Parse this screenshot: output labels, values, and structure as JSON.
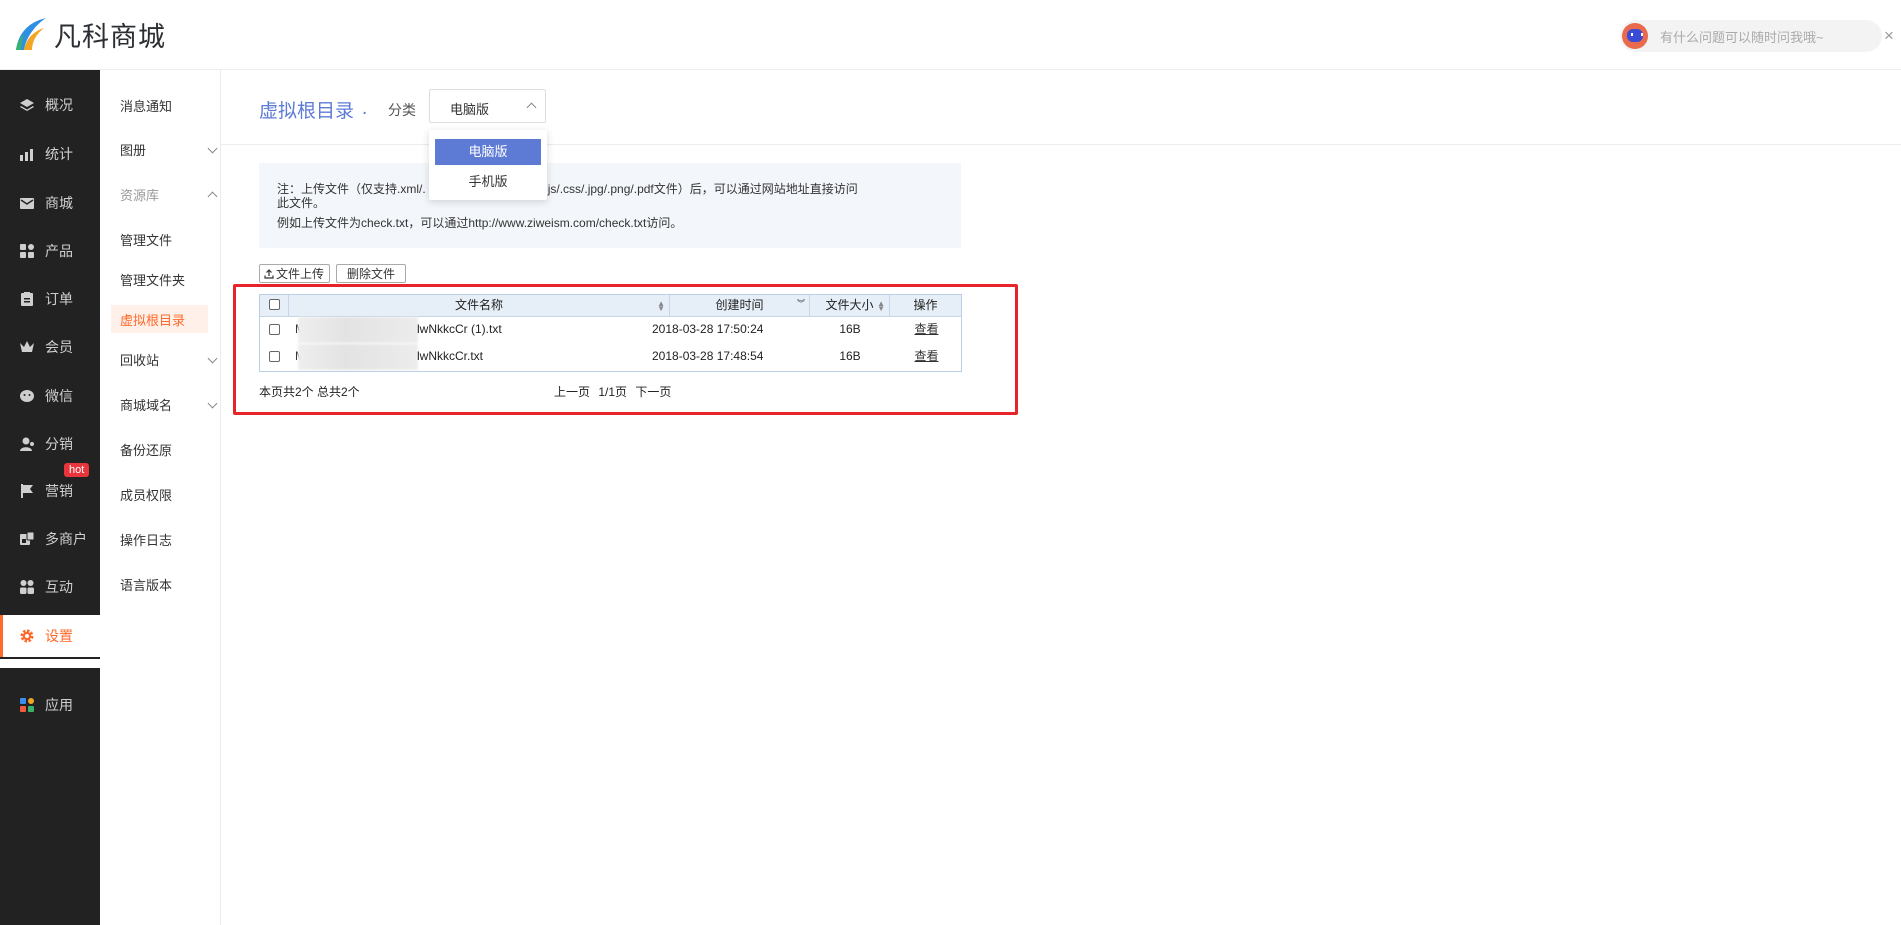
{
  "brand": {
    "name": "凡科商城"
  },
  "helper": {
    "placeholder": "有什么问题可以随时问我哦~",
    "close": "×"
  },
  "nav": {
    "items": [
      {
        "label": "概况",
        "icon": "layers-icon"
      },
      {
        "label": "统计",
        "icon": "chart-icon"
      },
      {
        "label": "商城",
        "icon": "mail-icon"
      },
      {
        "label": "产品",
        "icon": "grid-icon"
      },
      {
        "label": "订单",
        "icon": "clipboard-icon"
      },
      {
        "label": "会员",
        "icon": "crown-icon"
      },
      {
        "label": "微信",
        "icon": "wechat-icon"
      },
      {
        "label": "分销",
        "icon": "user-share-icon"
      },
      {
        "label": "营销",
        "icon": "flag-icon"
      },
      {
        "label": "多商户",
        "icon": "multi-shop-icon"
      },
      {
        "label": "互动",
        "icon": "people-icon"
      },
      {
        "label": "设置",
        "icon": "gear-icon"
      },
      {
        "label": "应用",
        "icon": "apps-icon"
      }
    ],
    "hot_badge": "hot",
    "active": "设置"
  },
  "subnav": {
    "items": [
      {
        "label": "消息通知"
      },
      {
        "label": "图册",
        "chevron": "down"
      },
      {
        "label": "资源库",
        "chevron": "up"
      },
      {
        "label": "管理文件"
      },
      {
        "label": "管理文件夹"
      },
      {
        "label": "虚拟根目录"
      },
      {
        "label": "回收站",
        "chevron": "down"
      },
      {
        "label": "商城域名",
        "chevron": "down"
      },
      {
        "label": "备份还原"
      },
      {
        "label": "成员权限"
      },
      {
        "label": "操作日志"
      },
      {
        "label": "语言版本"
      }
    ],
    "active": "虚拟根目录"
  },
  "header": {
    "title": "虚拟根目录",
    "title_suffix": ".",
    "category_label": "分类",
    "category_value": "电脑版",
    "category_options": [
      "电脑版",
      "手机版"
    ]
  },
  "note": {
    "line1_a": "注：上传文件（仅支持.xml/.",
    "line1_b": "/.cert/.bin/.js/.css/.jpg/.png/.pdf文件）后，可以通过网站地址直接访问",
    "line2": "此文件。",
    "line3": "例如上传文件为check.txt，可以通过http://www.ziweism.com/check.txt访问。"
  },
  "toolbar": {
    "upload": "文件上传",
    "delete": "删除文件"
  },
  "table": {
    "headers": [
      "文件名称",
      "创建时间",
      "文件大小",
      "操作"
    ],
    "rows": [
      {
        "prefix": "M",
        "name": "lwNkkcCr (1).txt",
        "time": "2018-03-28 17:50:24",
        "size": "16B",
        "action": "查看"
      },
      {
        "prefix": "M",
        "name": "lwNkkcCr.txt",
        "time": "2018-03-28 17:48:54",
        "size": "16B",
        "action": "查看"
      }
    ],
    "summary": "本页共2个 总共2个",
    "pager": {
      "prev": "上一页",
      "page": "1/1页",
      "next": "下一页"
    }
  },
  "colors": {
    "accent": "#ff6a2c",
    "brand_blue": "#5d7bd4",
    "highlight_red": "#e8242b",
    "nav_dark": "#222222"
  }
}
